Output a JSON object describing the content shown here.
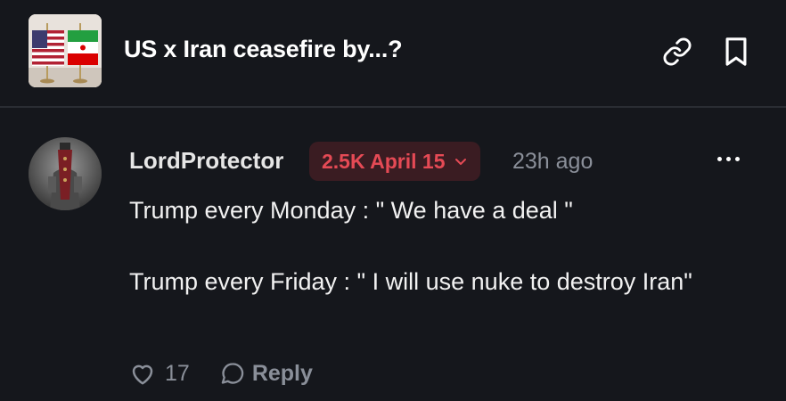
{
  "market": {
    "title": "US x Iran ceasefire by...?",
    "thumbnail_icon": "us-iran-flags-thumbnail",
    "actions": {
      "link_icon": "link-icon",
      "bookmark_icon": "bookmark-icon"
    }
  },
  "comment": {
    "username": "LordProtector",
    "position_badge": "2.5K April 15",
    "timestamp": "23h ago",
    "body_lines": [
      "Trump every Monday : \" We have a deal \"",
      "Trump every Friday : \" I will use nuke to destroy Iran\""
    ],
    "likes": "17",
    "reply_label": "Reply"
  },
  "colors": {
    "background": "#15171c",
    "divider": "#2a2d33",
    "badge_bg": "#3a1c22",
    "badge_text": "#e54a55",
    "muted_text": "#8a8f99"
  }
}
